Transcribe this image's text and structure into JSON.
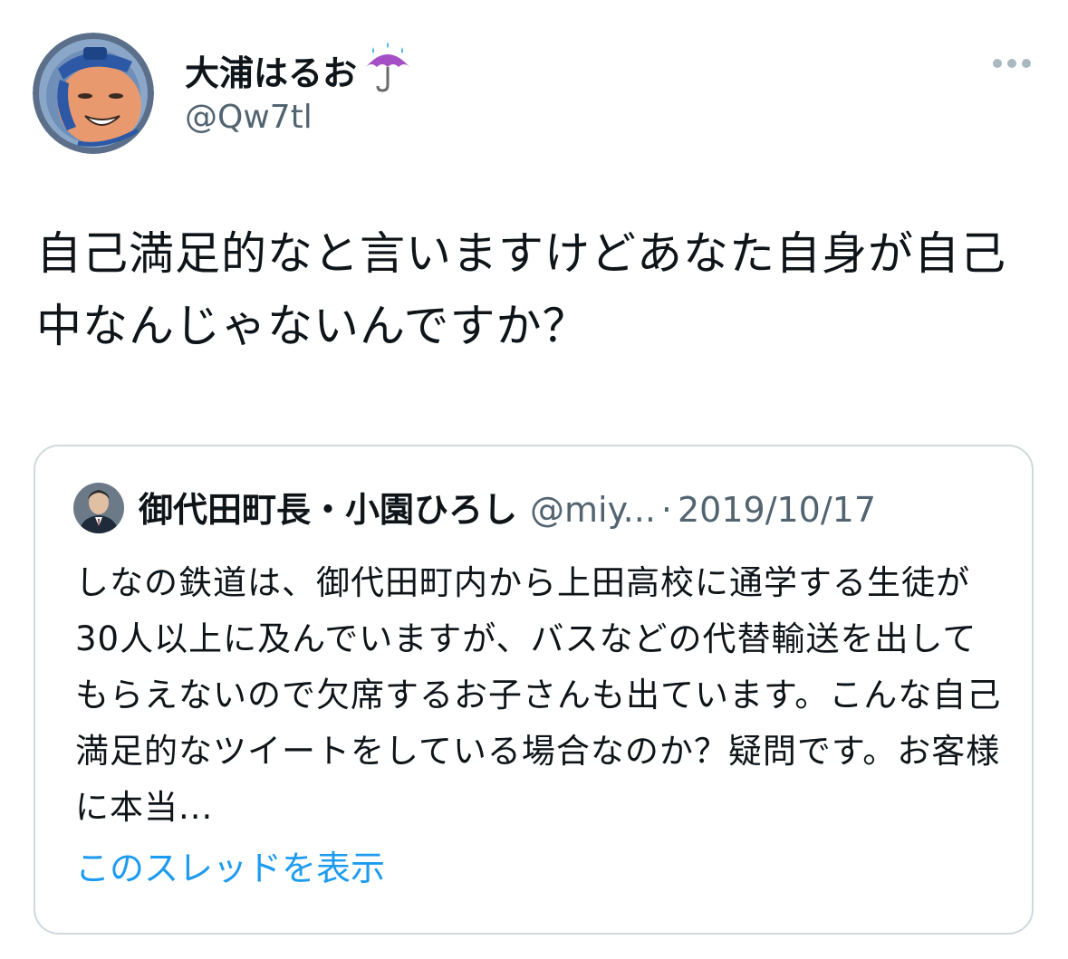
{
  "tweet": {
    "display_name": "大浦はるお",
    "handle": "@Qw7tl",
    "avatar_icon": "mascot-avatar-icon",
    "name_emoji_icon": "umbrella-with-rain-icon",
    "text": "自己満足的なと言いますけどあなた自身が自己中なんじゃないんですか？"
  },
  "quote": {
    "name": "御代田町長・小園ひろし",
    "handle": "@miy...",
    "separator": "·",
    "date": "2019/10/17",
    "text": "しなの鉄道は、御代田町内から上田高校に通学する生徒が30人以上に及んでいますが、バスなどの代替輸送を出してもらえないので欠席するお子さんも出ています。こんな自己満足的なツイートをしている場合なのか？疑問です。お客様に本当...",
    "show_thread_label": "このスレッドを表示"
  },
  "colors": {
    "text_primary": "#0f1419",
    "text_secondary": "#536471",
    "link": "#1d9bf0",
    "border": "#cfd9de"
  }
}
